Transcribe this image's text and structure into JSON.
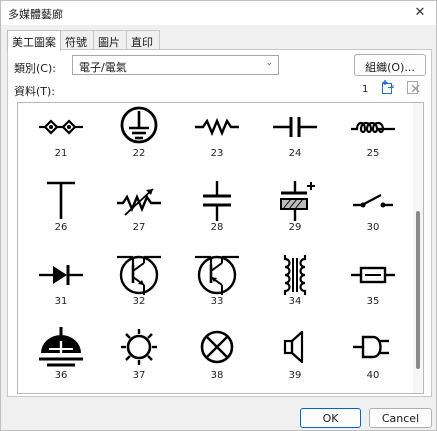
{
  "window": {
    "title": "多媒體藝廊",
    "close_glyph": "✕"
  },
  "tabs": [
    {
      "label": "美工圖案",
      "active": true
    },
    {
      "label": "符號",
      "active": false
    },
    {
      "label": "圖片",
      "active": false
    },
    {
      "label": "直印",
      "active": false
    }
  ],
  "category": {
    "label": "類別(C):",
    "value": "電子/電氣",
    "organize_label": "組織(O)..."
  },
  "data_label": "資料(T):",
  "page_number": "1",
  "symbols": [
    {
      "number": "21",
      "icon": "switch-symbol-icon"
    },
    {
      "number": "22",
      "icon": "ground-symbol-icon"
    },
    {
      "number": "23",
      "icon": "resistor-icon"
    },
    {
      "number": "24",
      "icon": "capacitor-icon"
    },
    {
      "number": "25",
      "icon": "inductor-icon"
    },
    {
      "number": "26",
      "icon": "junction-tee-icon"
    },
    {
      "number": "27",
      "icon": "variable-resistor-icon"
    },
    {
      "number": "28",
      "icon": "capacitor-vertical-icon"
    },
    {
      "number": "29",
      "icon": "battery-icon"
    },
    {
      "number": "30",
      "icon": "switch-icon"
    },
    {
      "number": "31",
      "icon": "diode-icon"
    },
    {
      "number": "32",
      "icon": "npn-transistor-icon"
    },
    {
      "number": "33",
      "icon": "pnp-transistor-icon"
    },
    {
      "number": "34",
      "icon": "transformer-icon"
    },
    {
      "number": "35",
      "icon": "fuse-icon"
    },
    {
      "number": "36",
      "icon": "antenna-ground-icon"
    },
    {
      "number": "37",
      "icon": "lamp-icon"
    },
    {
      "number": "38",
      "icon": "lamp-cross-icon"
    },
    {
      "number": "39",
      "icon": "speaker-icon"
    },
    {
      "number": "40",
      "icon": "plug-icon"
    }
  ],
  "buttons": {
    "ok": "OK",
    "cancel": "Cancel"
  },
  "colors": {
    "ok_border": "#0067c0",
    "icon_blue": "#1f6fd1"
  }
}
